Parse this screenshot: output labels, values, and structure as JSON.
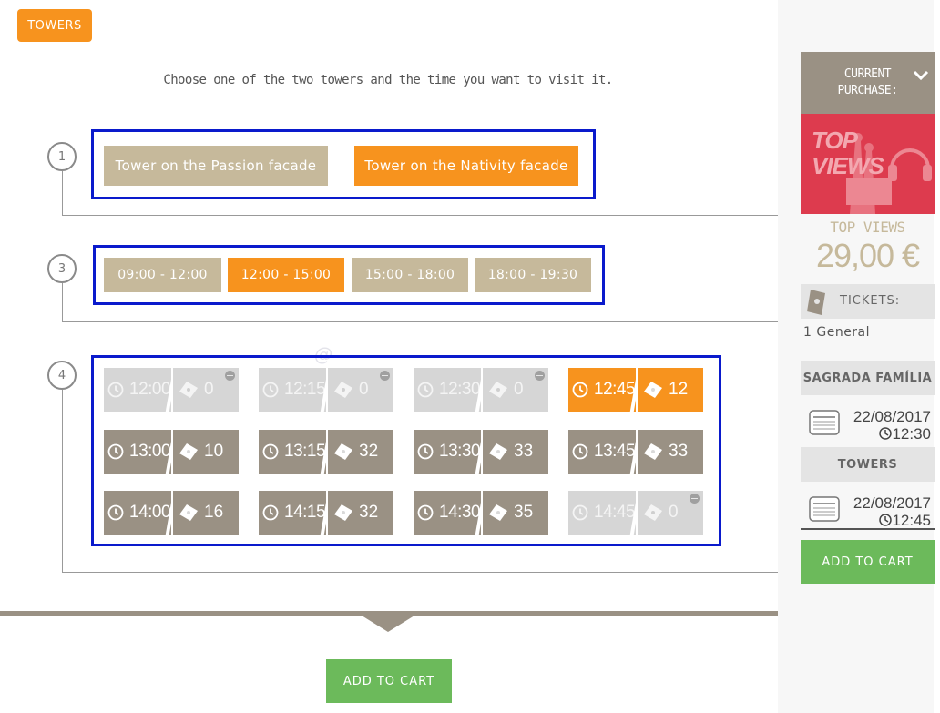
{
  "badge": "TOWERS",
  "instruction": "Choose one of the two towers and the time you want to visit it.",
  "steps": [
    "1",
    "3",
    "4"
  ],
  "towers": [
    {
      "label": "Tower on the Passion facade",
      "selected": false
    },
    {
      "label": "Tower on the Nativity facade",
      "selected": true
    }
  ],
  "ranges": [
    {
      "label": "09:00 - 12:00",
      "selected": false
    },
    {
      "label": "12:00 - 15:00",
      "selected": true
    },
    {
      "label": "15:00 - 18:00",
      "selected": false
    },
    {
      "label": "18:00 - 19:30",
      "selected": false
    }
  ],
  "slots": [
    {
      "time": "12:00",
      "count": "0",
      "state": "disabled"
    },
    {
      "time": "12:15",
      "count": "0",
      "state": "disabled"
    },
    {
      "time": "12:30",
      "count": "0",
      "state": "disabled"
    },
    {
      "time": "12:45",
      "count": "12",
      "state": "active"
    },
    {
      "time": "13:00",
      "count": "10",
      "state": "grey"
    },
    {
      "time": "13:15",
      "count": "32",
      "state": "grey"
    },
    {
      "time": "13:30",
      "count": "33",
      "state": "grey"
    },
    {
      "time": "13:45",
      "count": "33",
      "state": "grey"
    },
    {
      "time": "14:00",
      "count": "16",
      "state": "grey"
    },
    {
      "time": "14:15",
      "count": "32",
      "state": "grey"
    },
    {
      "time": "14:30",
      "count": "35",
      "state": "grey"
    },
    {
      "time": "14:45",
      "count": "0",
      "state": "disabled"
    }
  ],
  "add_to_cart": "ADD TO CART",
  "sidebar": {
    "header_line1": "CURRENT",
    "header_line2": "PURCHASE:",
    "image_text_line1": "TOP",
    "image_text_line2": "VIEWS",
    "product_name": "TOP VIEWS",
    "price": "29,00 €",
    "tickets_label": "TICKETS:",
    "ticket_line": "1 General",
    "section1": "SAGRADA FAMÍLIA",
    "date1": "22/08/2017",
    "time1": "12:30",
    "section2": "TOWERS",
    "date2": "22/08/2017",
    "time2": "12:45",
    "add_to_cart": "ADD TO CART"
  },
  "colors": {
    "accent": "#f7931e",
    "tan": "#c6b99b",
    "slot_grey": "#9a9184",
    "disabled": "#d6d6d6",
    "green": "#6cba5b",
    "selection_outline": "#0a1acc",
    "topviews_red": "#dd3b4e"
  }
}
